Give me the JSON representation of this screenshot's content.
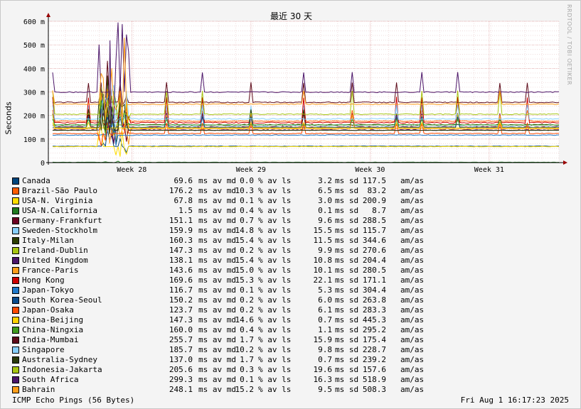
{
  "watermark": "RRDTOOL / TOBI OETIKER",
  "footer": {
    "left": "ICMP Echo Pings (56 Bytes)",
    "right": "Fri Aug  1 16:17:23 2025"
  },
  "chart_data": {
    "type": "line",
    "title": "最近 30 天",
    "ylabel": "Seconds",
    "xlabel": "",
    "ylim": [
      0,
      600
    ],
    "yticks": [
      0,
      100,
      200,
      300,
      400,
      500,
      600
    ],
    "ytick_labels": [
      "0",
      "100 m",
      "200 m",
      "300 m",
      "400 m",
      "500 m",
      "600 m"
    ],
    "xlim": [
      0,
      30
    ],
    "xticks": [
      {
        "label": "Week 28",
        "x": 4.9
      },
      {
        "label": "Week 29",
        "x": 11.9
      },
      {
        "label": "Week 30",
        "x": 18.9
      },
      {
        "label": "Week 31",
        "x": 25.9
      }
    ],
    "grid": true,
    "spike_days": [
      0.3,
      2.3,
      3.1,
      3.5,
      4.2,
      6.9,
      9.0,
      11.9,
      15.0,
      17.9,
      20.4,
      22.0,
      24.0,
      26.5,
      28.2
    ],
    "series": [
      {
        "name": "Canada",
        "color": "#00457c",
        "median": 69.6,
        "loss": "0.0 %",
        "sd": 3.2,
        "am": 117.5,
        "md_s": "69.6",
        "ls_s": "0.0",
        "sd_s": "3.2",
        "am_s": "117.5"
      },
      {
        "name": "Brazil-São Paulo",
        "color": "#ff5c00",
        "median": 176.2,
        "loss": "10.3 %",
        "sd": 6.5,
        "am": 83.2,
        "md_s": "176.2",
        "ls_s": "10.3",
        "sd_s": "6.5",
        "am_s": "83.2"
      },
      {
        "name": "USA-N. Virginia",
        "color": "#ffde00",
        "median": 67.8,
        "loss": "0.1 %",
        "sd": 3.0,
        "am": 200.9,
        "md_s": "67.8",
        "ls_s": "0.1",
        "sd_s": "3.0",
        "am_s": "200.9"
      },
      {
        "name": "USA-N.California",
        "color": "#207a20",
        "median": 1.5,
        "loss": "0.4 %",
        "sd": 0.1,
        "am": 8.7,
        "md_s": "1.5",
        "ls_s": "0.4",
        "sd_s": "0.1",
        "am_s": "8.7"
      },
      {
        "name": "Germany-Frankfurt",
        "color": "#6c0022",
        "median": 151.1,
        "loss": "0.7 %",
        "sd": 9.6,
        "am": 288.5,
        "md_s": "151.1",
        "ls_s": "0.7",
        "sd_s": "9.6",
        "am_s": "288.5"
      },
      {
        "name": "Sweden-Stockholm",
        "color": "#87cefa",
        "median": 159.9,
        "loss": "14.8 %",
        "sd": 15.5,
        "am": 115.7,
        "md_s": "159.9",
        "ls_s": "14.8",
        "sd_s": "15.5",
        "am_s": "115.7"
      },
      {
        "name": "Italy-Milan",
        "color": "#2c3e00",
        "median": 160.3,
        "loss": "15.4 %",
        "sd": 11.5,
        "am": 344.6,
        "md_s": "160.3",
        "ls_s": "15.4",
        "sd_s": "11.5",
        "am_s": "344.6"
      },
      {
        "name": "Ireland-Dublin",
        "color": "#a6c512",
        "median": 147.3,
        "loss": "0.2 %",
        "sd": 9.9,
        "am": 270.6,
        "md_s": "147.3",
        "ls_s": "0.2",
        "sd_s": "9.9",
        "am_s": "270.6"
      },
      {
        "name": "United Kingdom",
        "color": "#4b166a",
        "median": 138.1,
        "loss": "15.4 %",
        "sd": 10.8,
        "am": 204.4,
        "md_s": "138.1",
        "ls_s": "15.4",
        "sd_s": "10.8",
        "am_s": "204.4"
      },
      {
        "name": "France-Paris",
        "color": "#ff9d1a",
        "median": 143.6,
        "loss": "15.0 %",
        "sd": 10.1,
        "am": 280.5,
        "md_s": "143.6",
        "ls_s": "15.0",
        "sd_s": "10.1",
        "am_s": "280.5"
      },
      {
        "name": "Hong Kong",
        "color": "#cc0000",
        "median": 169.6,
        "loss": "15.3 %",
        "sd": 22.1,
        "am": 171.1,
        "md_s": "169.6",
        "ls_s": "15.3",
        "sd_s": "22.1",
        "am_s": "171.1"
      },
      {
        "name": "Japan-Tokyo",
        "color": "#1f78c8",
        "median": 116.7,
        "loss": "0.1 %",
        "sd": 5.3,
        "am": 304.4,
        "md_s": "116.7",
        "ls_s": "0.1",
        "sd_s": "5.3",
        "am_s": "304.4"
      },
      {
        "name": "South Korea-Seoul",
        "color": "#0a4b8c",
        "median": 150.2,
        "loss": "0.2 %",
        "sd": 6.0,
        "am": 263.8,
        "md_s": "150.2",
        "ls_s": "0.2",
        "sd_s": "6.0",
        "am_s": "263.8"
      },
      {
        "name": "Japan-Osaka",
        "color": "#ff4a00",
        "median": 123.7,
        "loss": "0.2 %",
        "sd": 6.1,
        "am": 283.3,
        "md_s": "123.7",
        "ls_s": "0.2",
        "sd_s": "6.1",
        "am_s": "283.3"
      },
      {
        "name": "China-Beijing",
        "color": "#ffd200",
        "median": 147.3,
        "loss": "14.6 %",
        "sd": 0.7,
        "am": 445.3,
        "md_s": "147.3",
        "ls_s": "14.6",
        "sd_s": "0.7",
        "am_s": "445.3"
      },
      {
        "name": "China-Ningxia",
        "color": "#409a1e",
        "median": 160.0,
        "loss": "0.4 %",
        "sd": 1.1,
        "am": 295.2,
        "md_s": "160.0",
        "ls_s": "0.4",
        "sd_s": "1.1",
        "am_s": "295.2"
      },
      {
        "name": "India-Mumbai",
        "color": "#5e0b1a",
        "median": 255.7,
        "loss": "1.7 %",
        "sd": 15.9,
        "am": 175.4,
        "md_s": "255.7",
        "ls_s": "1.7",
        "sd_s": "15.9",
        "am_s": "175.4"
      },
      {
        "name": "Singapore",
        "color": "#87cefa",
        "median": 185.7,
        "loss": "10.2 %",
        "sd": 9.8,
        "am": 228.7,
        "md_s": "185.7",
        "ls_s": "10.2",
        "sd_s": "9.8",
        "am_s": "228.7"
      },
      {
        "name": "Australia-Sydney",
        "color": "#2a3a0a",
        "median": 137.0,
        "loss": "1.7 %",
        "sd": 0.7,
        "am": 239.2,
        "md_s": "137.0",
        "ls_s": "1.7",
        "sd_s": "0.7",
        "am_s": "239.2"
      },
      {
        "name": "Indonesia-Jakarta",
        "color": "#a6c512",
        "median": 205.6,
        "loss": "0.3 %",
        "sd": 19.6,
        "am": 157.6,
        "md_s": "205.6",
        "ls_s": "0.3",
        "sd_s": "19.6",
        "am_s": "157.6"
      },
      {
        "name": "South Africa",
        "color": "#4b166a",
        "median": 299.3,
        "loss": "0.1 %",
        "sd": 16.3,
        "am": 518.9,
        "md_s": "299.3",
        "ls_s": "0.1",
        "sd_s": "16.3",
        "am_s": "518.9"
      },
      {
        "name": "Bahrain",
        "color": "#ff9d1a",
        "median": 248.1,
        "loss": "15.2 %",
        "sd": 9.5,
        "am": 508.3,
        "md_s": "248.1",
        "ls_s": "15.2",
        "sd_s": "9.5",
        "am_s": "508.3"
      }
    ],
    "legend_units": {
      "md": "ms av md",
      "ls": "% av ls",
      "sd": "ms sd",
      "am": "am/as"
    }
  }
}
